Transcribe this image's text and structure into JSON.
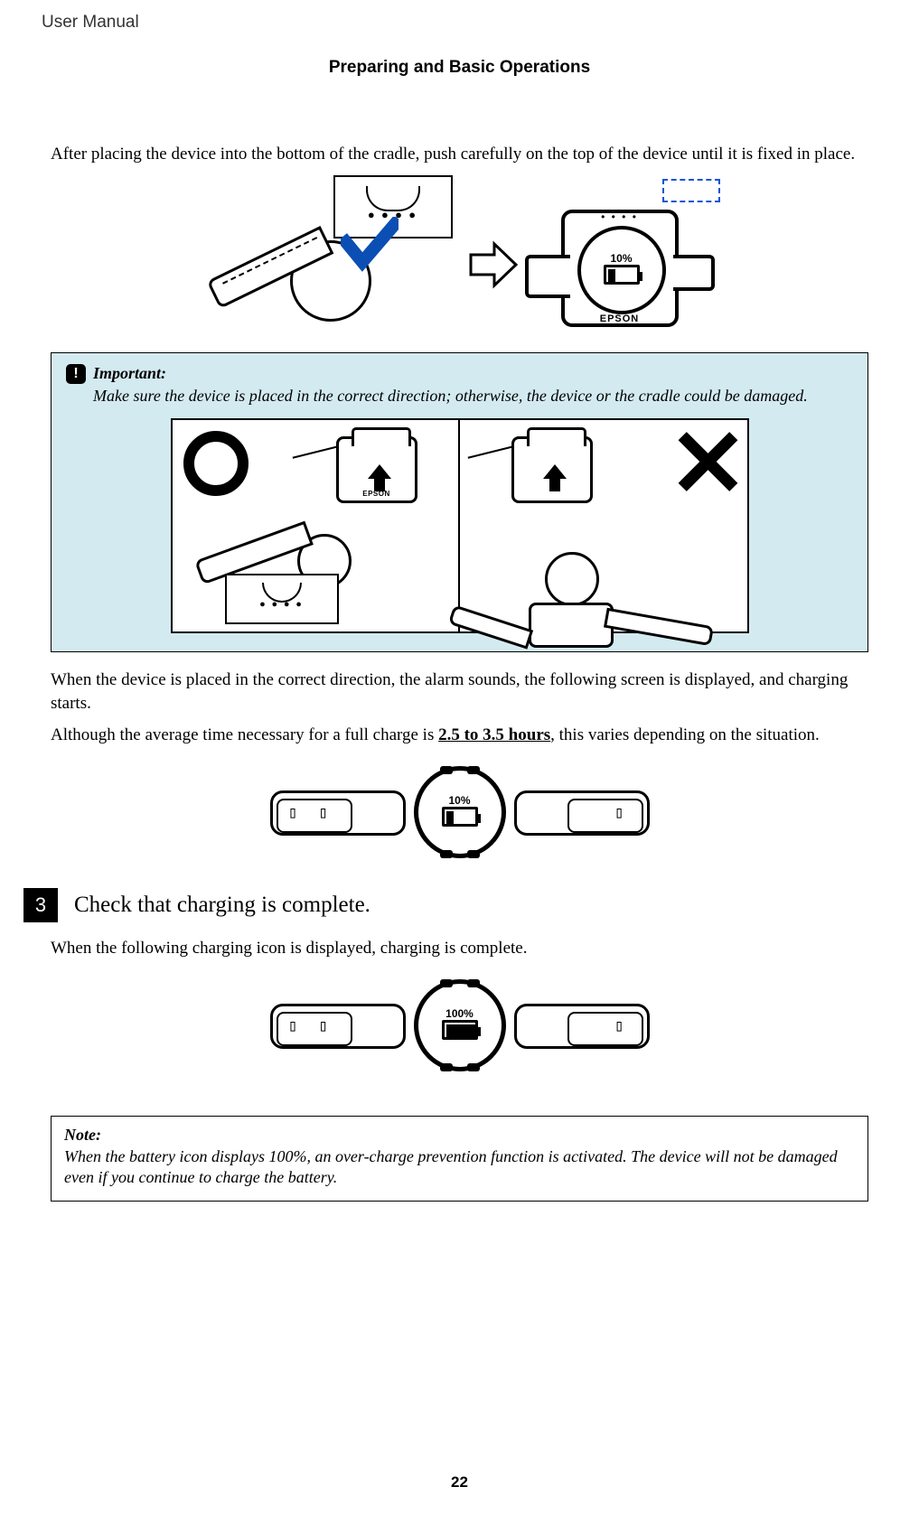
{
  "header_title": "User Manual",
  "section_title": "Preparing and Basic Operations",
  "intro_para": "After placing the device into the bottom of the cradle, push carefully on the top of the device until it is fixed in place.",
  "fig1": {
    "battery_pct": "10%",
    "brand": "EPSON"
  },
  "important": {
    "label": "Important:",
    "text": "Make sure the device is placed in the correct direction; otherwise, the device or the cradle could be damaged.",
    "brand": "EPSON"
  },
  "after_para1": "When the device is placed in the correct direction, the alarm sounds, the following screen is displayed, and charging starts.",
  "after_para2_pre": "Although the average time necessary for a full charge is ",
  "after_para2_dur": "2.5 to 3.5 hours",
  "after_para2_post": ", this varies depending on the situation.",
  "fig2": {
    "battery_pct": "10%"
  },
  "step3": {
    "number": "3",
    "title": "Check that charging is complete."
  },
  "step3_body": "When the following charging icon is displayed, charging is complete.",
  "fig3": {
    "battery_pct": "100%"
  },
  "note": {
    "label": "Note:",
    "text": "When the battery icon displays 100%, an over-charge prevention function is activated. The device will not be damaged even if you continue to charge the battery."
  },
  "page_number": "22"
}
